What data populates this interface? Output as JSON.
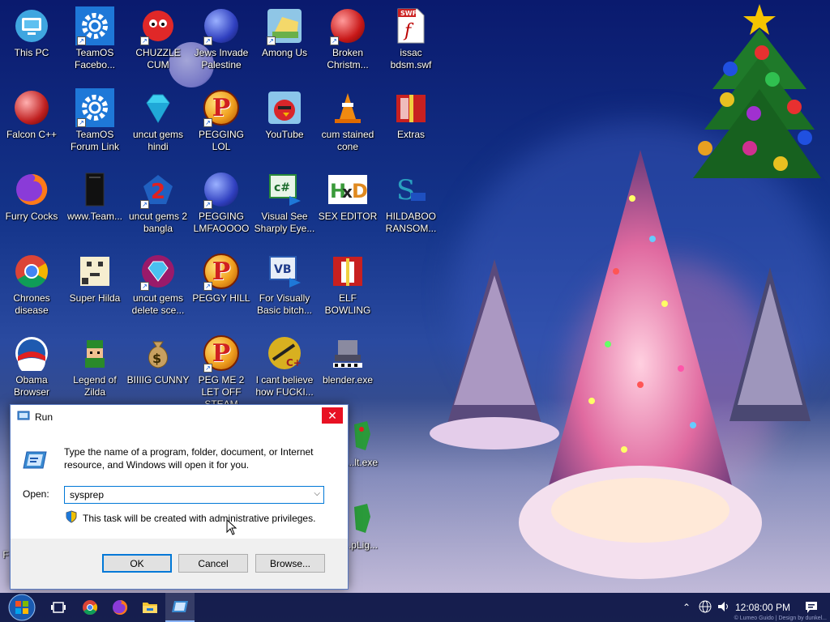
{
  "desktop": {
    "icons": [
      {
        "label": "This PC",
        "icon": "monitor-icon"
      },
      {
        "label": "TeamOS Facebo...",
        "icon": "settings-gear-icon"
      },
      {
        "label": "CHUZZLE CUM",
        "icon": "chuzzle-icon"
      },
      {
        "label": "Jews Invade Palestine",
        "icon": "ornament-ball-icon"
      },
      {
        "label": "Among Us",
        "icon": "among-us-icon"
      },
      {
        "label": "Broken Christm...",
        "icon": "christmas-ornament-icon"
      },
      {
        "label": "issac bdsm.swf",
        "icon": "swf-file-icon"
      },
      {
        "label": "Falcon C++",
        "icon": "falcon-ornament-icon"
      },
      {
        "label": "TeamOS Forum Link",
        "icon": "settings-gear-icon"
      },
      {
        "label": "uncut gems hindi",
        "icon": "diamond-icon"
      },
      {
        "label": "PEGGING LOL",
        "icon": "peggle-icon"
      },
      {
        "label": "YouTube",
        "icon": "angry-birds-icon"
      },
      {
        "label": "cum stained cone",
        "icon": "traffic-cone-icon"
      },
      {
        "label": "Extras",
        "icon": "gift-box-icon"
      },
      {
        "label": "Furry Cocks",
        "icon": "firefox-icon"
      },
      {
        "label": "www.Team...",
        "icon": "black-file-icon"
      },
      {
        "label": "uncut gems 2 bangla",
        "icon": "bejeweled2-icon"
      },
      {
        "label": "PEGGING LMFAOOOO",
        "icon": "ornament-ball-icon"
      },
      {
        "label": "Visual See Sharply Eye...",
        "icon": "csharp-icon"
      },
      {
        "label": "SEX EDITOR",
        "icon": "hxd-icon"
      },
      {
        "label": "HILDABOO RANSOM...",
        "icon": "script-icon"
      },
      {
        "label": "Chrones disease",
        "icon": "chrome-icon"
      },
      {
        "label": "Super Hilda",
        "icon": "pixel-character-icon"
      },
      {
        "label": "uncut gems delete sce...",
        "icon": "bejeweled-icon"
      },
      {
        "label": "PEGGY HILL",
        "icon": "peggle-icon"
      },
      {
        "label": "For Visually Basic bitch...",
        "icon": "vb-icon"
      },
      {
        "label": "ELF BOWLING",
        "icon": "book-icon"
      },
      {
        "label": "Obama Browser",
        "icon": "obama-logo-icon"
      },
      {
        "label": "Legend of Zilda",
        "icon": "zelda-link-icon"
      },
      {
        "label": "BIIIIG CUNNY",
        "icon": "money-bag-icon"
      },
      {
        "label": "PEG ME 2 LET OFF STEAM",
        "icon": "peggle-icon"
      },
      {
        "label": "I cant believe how FUCKI...",
        "icon": "cplusplus-icon"
      },
      {
        "label": "blender.exe",
        "icon": "blender-exe-icon"
      },
      {
        "label": "...lt.exe",
        "icon": "green-exe-icon"
      },
      {
        "label": "...pLig...",
        "icon": "green-exe-icon"
      },
      {
        "label": "F",
        "icon": "partial-icon"
      }
    ]
  },
  "run_dialog": {
    "title": "Run",
    "description": "Type the name of a program, folder, document, or Internet resource, and Windows will open it for you.",
    "open_label": "Open:",
    "input_value": "sysprep",
    "admin_note": "This task will be created with administrative privileges.",
    "ok_label": "OK",
    "cancel_label": "Cancel",
    "browse_label": "Browse...",
    "close_glyph": "✕"
  },
  "taskbar": {
    "start_icon": "windows-7-orb-icon",
    "items": [
      "task-view-icon",
      "chrome-icon",
      "firefox-icon",
      "file-explorer-icon",
      "run-icon"
    ],
    "clock": "12:08:00 PM",
    "watermark": "© Lumeo Guido | Design by dunkel..."
  },
  "colors": {
    "accent": "#0078d7",
    "close_red": "#e81123",
    "taskbar": "#0a1446"
  }
}
